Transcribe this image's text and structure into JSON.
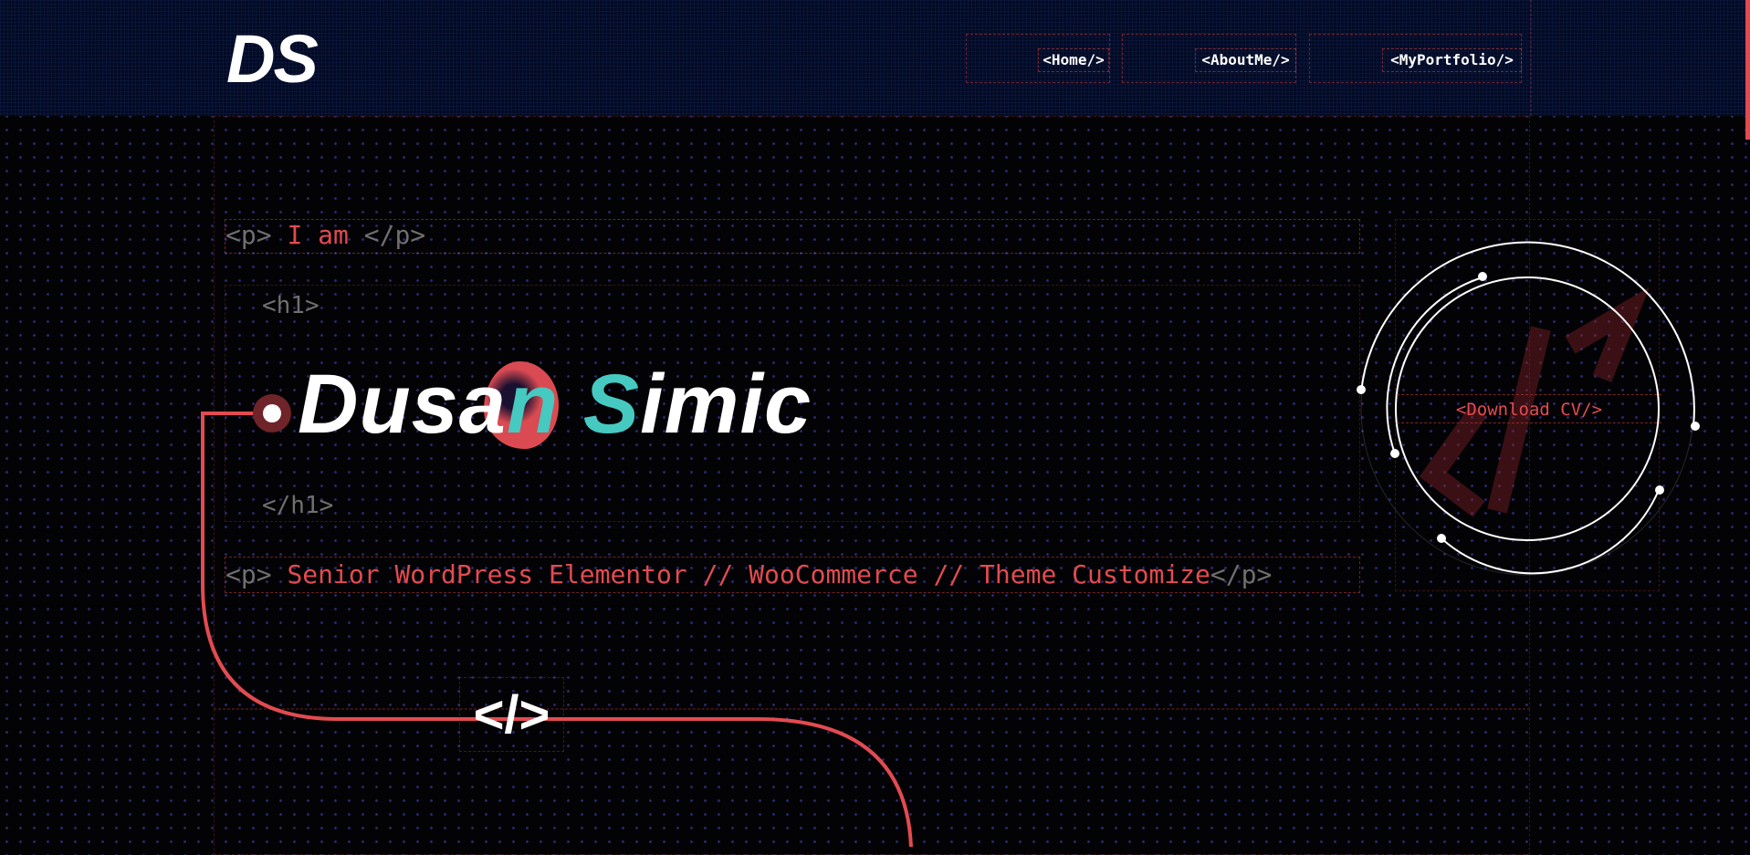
{
  "header": {
    "logo": "DS",
    "nav": [
      {
        "label": "<Home/>"
      },
      {
        "label": "<AboutMe/>"
      },
      {
        "label": "<MyPortfolio/>"
      }
    ]
  },
  "hero": {
    "intro": {
      "open_tag": "<p>",
      "text": "I am",
      "close_tag": "</p>"
    },
    "h1_open": "<h1>",
    "name_part1": "Dusa",
    "name_part2": "n S",
    "name_part3": "imic",
    "h1_close": "</h1>",
    "role": {
      "open_tag": "<p>",
      "text": "Senior WordPress Elementor // WooCommerce // Theme Customize",
      "close_tag": "</p>"
    },
    "download_cv": "<Download CV/>",
    "code_symbol": "</>"
  },
  "colors": {
    "accent": "#e24b51",
    "teal": "#46c9c0",
    "header_bg": "#020a24",
    "body_bg": "#030305",
    "tag_gray": "#6f6f6f"
  }
}
